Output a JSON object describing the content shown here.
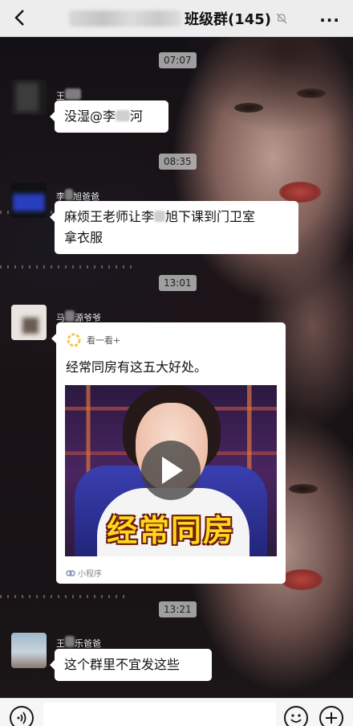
{
  "header": {
    "back_icon": "chevron-left-icon",
    "title": "班级群(145)",
    "mute_icon": "bell-mute-icon",
    "more_label": "···"
  },
  "messages": [
    {
      "time": "07:07"
    },
    {
      "sender": "王",
      "text_a": "没湿@李",
      "text_b": "河",
      "avatar_color": "#2b2b2b"
    },
    {
      "time": "08:35"
    },
    {
      "sender_a": "李",
      "sender_b": "旭爸爸",
      "line1_a": "麻烦王老师让李",
      "line1_b": "旭下课到门卫室",
      "line2": "拿衣服",
      "avatar_color": "#2a3fc0"
    },
    {
      "time": "13:01"
    },
    {
      "sender_a": "马",
      "sender_b": "源爷爷",
      "avatar_color": "#e8e4e0"
    },
    {
      "sender_a": "王",
      "sender_b": "乐爸爸",
      "text": "这个群里不宜发这些",
      "avatar_color": "#9fb8cc"
    },
    {
      "time": "13:21"
    }
  ],
  "mini_program": {
    "source_name": "看一看+",
    "title": "经常同房有这五大好处。",
    "thumbnail_caption": "经常同房",
    "play_icon": "play-icon",
    "footer_label": "小程序",
    "footer_icon": "mini-program-icon",
    "accent_color": "#f2c94c"
  },
  "input_bar": {
    "voice_icon": "voice-icon",
    "emoji_icon": "emoji-icon",
    "plus_icon": "plus-icon"
  }
}
